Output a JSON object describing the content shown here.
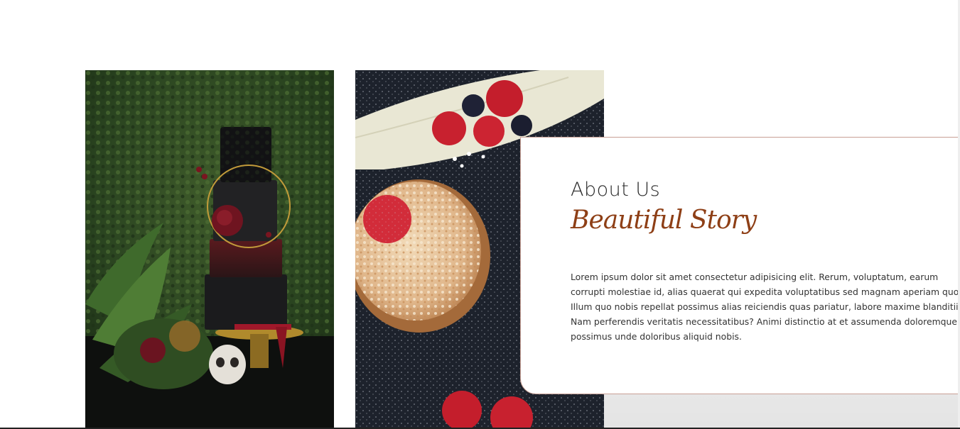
{
  "about": {
    "eyebrow": "About Us",
    "title": "Beautiful Story",
    "body": "Lorem ipsum dolor sit amet consectetur adipisicing elit. Rerum, voluptatum, earum corrupti molestiae id, alias quaerat qui expedita voluptatibus sed magnam aperiam quos. Illum quo nobis repellat possimus alias reiciendis quas pariatur, labore maxime blanditiis. Nam perferendis veritatis necessitatibus? Animi distinctio at et assumenda doloremque possimus unde doloribus aliquid nobis."
  },
  "images": {
    "first": "tiered-cake-photo",
    "second": "berry-tart-photo"
  },
  "colors": {
    "title_accent": "#8e3f16",
    "card_border": "#c9a095",
    "body_text": "#333333"
  }
}
